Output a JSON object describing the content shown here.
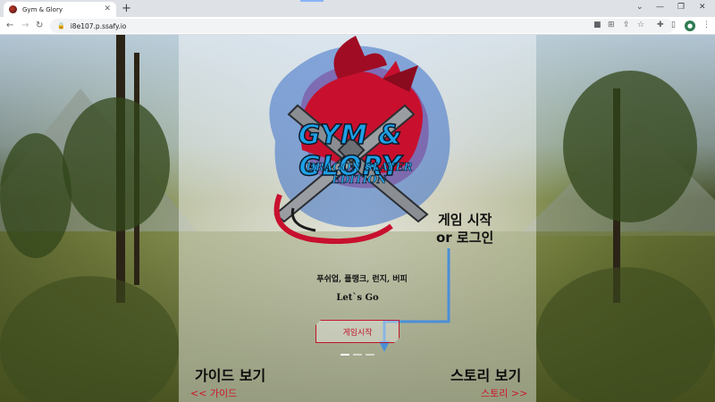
{
  "browser": {
    "tab_title": "Gym & Glory",
    "tab_close": "✕",
    "new_tab": "+",
    "url": "i8e107.p.ssafy.io",
    "window_controls": {
      "dropdown": "⌄",
      "minimize": "—",
      "restore": "❐",
      "close": "✕"
    },
    "nav": {
      "back": "←",
      "forward": "→",
      "reload": "↻"
    },
    "profile_initial": "●"
  },
  "logo": {
    "title": "GYM & GLORY",
    "subtitle": "DRAGON SLAYER EDITION",
    "colors": {
      "dragon": "#c8102e",
      "text": "#1ea0e6",
      "blade": "#8a8d91"
    }
  },
  "annotation": {
    "line1": "게임 시작",
    "line2": "or 로그인",
    "arrow_color": "#4a8fd8"
  },
  "main": {
    "exercise_list": "푸쉬업, 플랭크, 런지, 버피",
    "lets_go": "Let`s Go",
    "start_button": "게임시작"
  },
  "guide": {
    "title": "가이드 보기",
    "link": "<< 가이드"
  },
  "story": {
    "title": "스토리 보기",
    "link": "스토리 >>"
  },
  "pager": {
    "count": 3,
    "active": 0
  }
}
